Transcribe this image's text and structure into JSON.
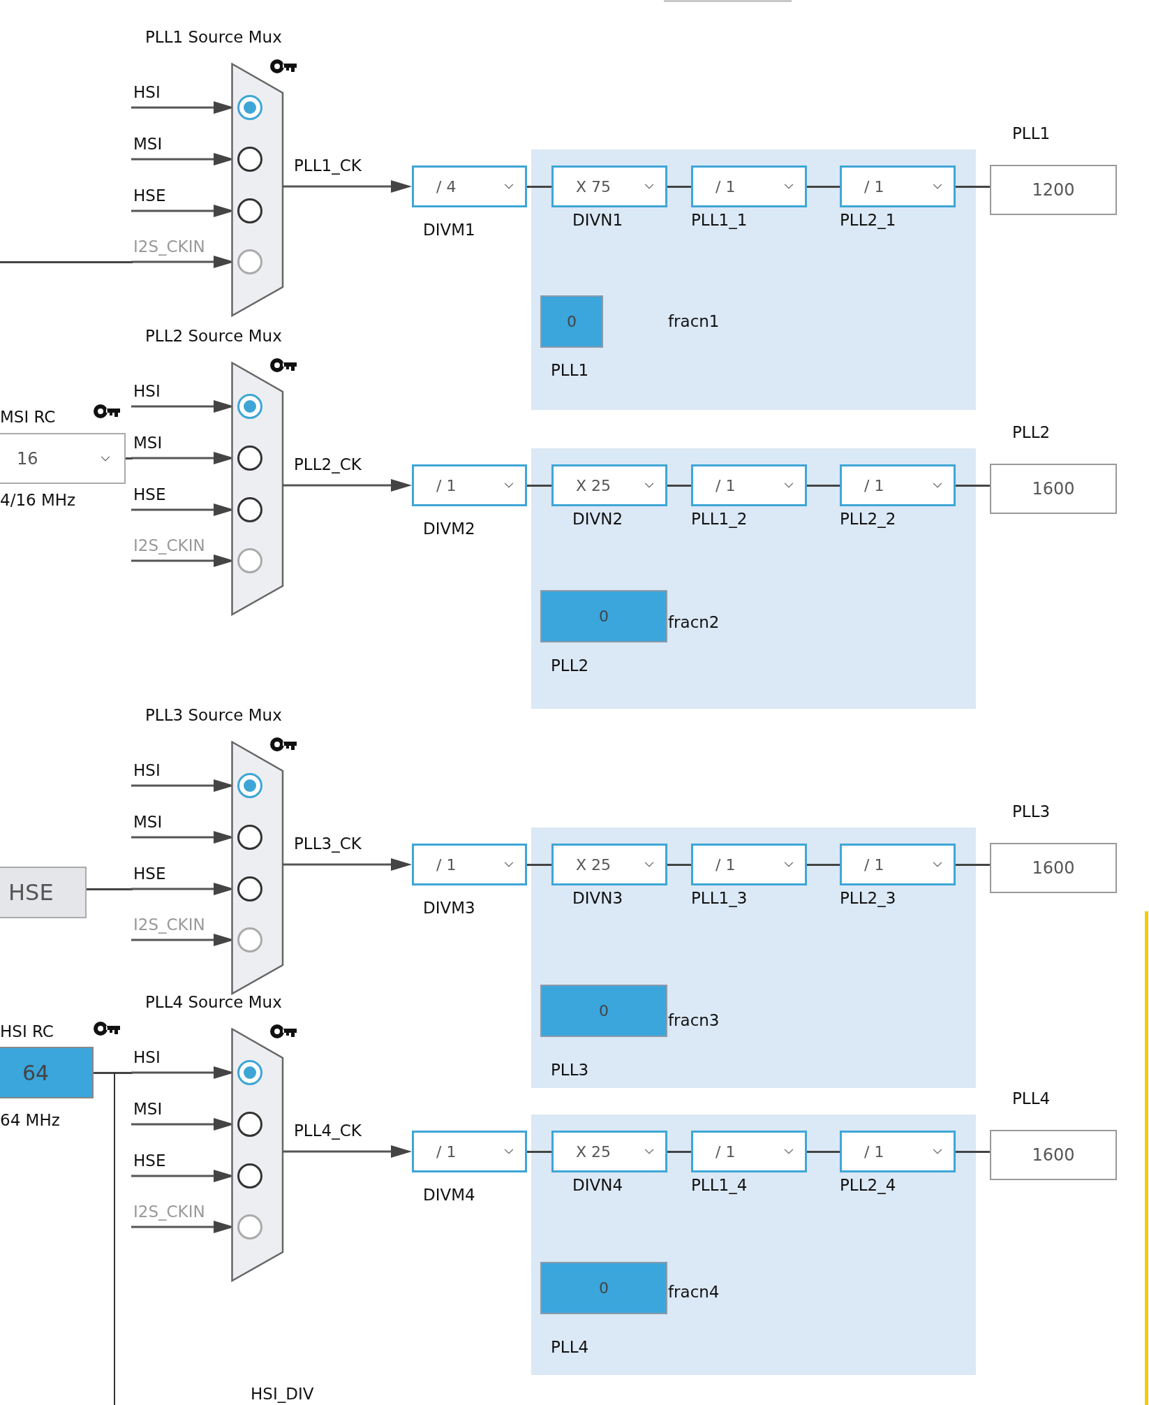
{
  "sections": [
    {
      "mux": {
        "title": "PLL1 Source Mux",
        "output": "PLL1_CK",
        "inputs": [
          {
            "label": "HSI",
            "selected": true,
            "disabled": false
          },
          {
            "label": "MSI",
            "selected": false,
            "disabled": false
          },
          {
            "label": "HSE",
            "selected": false,
            "disabled": false
          },
          {
            "label": "I2S_CKIN",
            "selected": false,
            "disabled": true
          }
        ]
      },
      "pll": {
        "title": "PLL1",
        "divm": {
          "value": "/ 4",
          "label": "DIVM1"
        },
        "dividers": [
          {
            "value": "X 75",
            "label": "DIVN1"
          },
          {
            "value": "/ 1",
            "label": "PLL1_1"
          },
          {
            "value": "/ 1",
            "label": "PLL2_1"
          }
        ],
        "frac": {
          "value": "0",
          "name": "fracn1",
          "label": "PLL1"
        },
        "output": "1200"
      }
    },
    {
      "mux": {
        "title": "PLL2 Source Mux",
        "output": "PLL2_CK",
        "inputs": [
          {
            "label": "HSI",
            "selected": true,
            "disabled": false
          },
          {
            "label": "MSI",
            "selected": false,
            "disabled": false
          },
          {
            "label": "HSE",
            "selected": false,
            "disabled": false
          },
          {
            "label": "I2S_CKIN",
            "selected": false,
            "disabled": true
          }
        ]
      },
      "pll": {
        "title": "PLL2",
        "divm": {
          "value": "/ 1",
          "label": "DIVM2"
        },
        "dividers": [
          {
            "value": "X 25",
            "label": "DIVN2"
          },
          {
            "value": "/ 1",
            "label": "PLL1_2"
          },
          {
            "value": "/ 1",
            "label": "PLL2_2"
          }
        ],
        "frac": {
          "value": "0",
          "name": "fracn2",
          "label": "PLL2"
        },
        "output": "1600"
      }
    },
    {
      "mux": {
        "title": "PLL3 Source Mux",
        "output": "PLL3_CK",
        "inputs": [
          {
            "label": "HSI",
            "selected": true,
            "disabled": false
          },
          {
            "label": "MSI",
            "selected": false,
            "disabled": false
          },
          {
            "label": "HSE",
            "selected": false,
            "disabled": false
          },
          {
            "label": "I2S_CKIN",
            "selected": false,
            "disabled": true
          }
        ]
      },
      "pll": {
        "title": "PLL3",
        "divm": {
          "value": "/ 1",
          "label": "DIVM3"
        },
        "dividers": [
          {
            "value": "X 25",
            "label": "DIVN3"
          },
          {
            "value": "/ 1",
            "label": "PLL1_3"
          },
          {
            "value": "/ 1",
            "label": "PLL2_3"
          }
        ],
        "frac": {
          "value": "0",
          "name": "fracn3",
          "label": "PLL3"
        },
        "output": "1600"
      }
    },
    {
      "mux": {
        "title": "PLL4 Source Mux",
        "output": "PLL4_CK",
        "inputs": [
          {
            "label": "HSI",
            "selected": true,
            "disabled": false
          },
          {
            "label": "MSI",
            "selected": false,
            "disabled": false
          },
          {
            "label": "HSE",
            "selected": false,
            "disabled": false
          },
          {
            "label": "I2S_CKIN",
            "selected": false,
            "disabled": true
          }
        ]
      },
      "pll": {
        "title": "PLL4",
        "divm": {
          "value": "/ 1",
          "label": "DIVM4"
        },
        "dividers": [
          {
            "value": "X 25",
            "label": "DIVN4"
          },
          {
            "value": "/ 1",
            "label": "PLL1_4"
          },
          {
            "value": "/ 1",
            "label": "PLL2_4"
          }
        ],
        "frac": {
          "value": "0",
          "name": "fracn4",
          "label": "PLL4"
        },
        "output": "1600"
      }
    }
  ],
  "msi_rc": {
    "title": "MSI RC",
    "value": "16",
    "range": "4/16 MHz"
  },
  "hse": {
    "label": "HSE"
  },
  "hsi_rc": {
    "title": "HSI RC",
    "value": "64",
    "range": "64 MHz"
  },
  "hsi_div": {
    "title": "HSI_DIV"
  }
}
